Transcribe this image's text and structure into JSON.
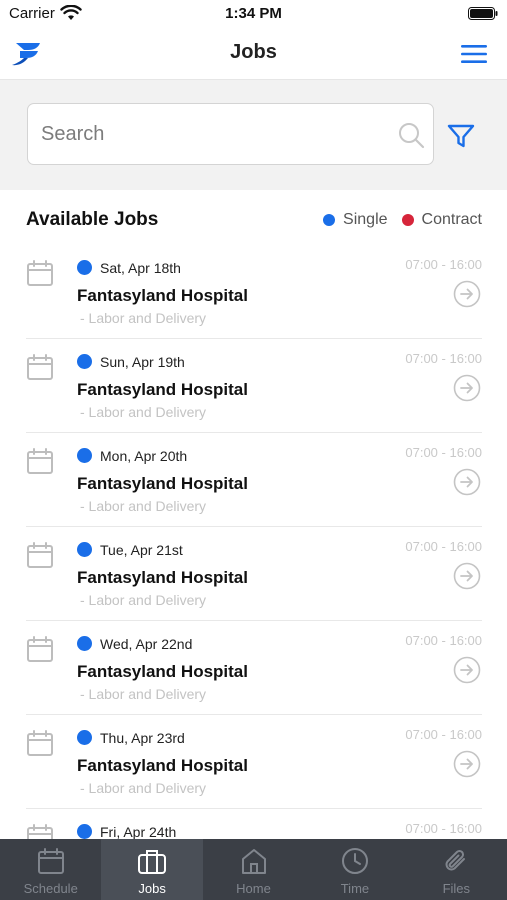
{
  "status_bar": {
    "carrier": "Carrier",
    "time": "1:34 PM"
  },
  "navbar": {
    "title": "Jobs"
  },
  "search": {
    "placeholder": "Search",
    "value": ""
  },
  "section": {
    "title": "Available Jobs",
    "legend": [
      {
        "label": "Single",
        "color": "#1a6ee8"
      },
      {
        "label": "Contract",
        "color": "#d6253a"
      }
    ]
  },
  "jobs": [
    {
      "date": "Sat, Apr 18th",
      "hospital": "Fantasyland Hospital",
      "department": "- Labor and Delivery",
      "time": "07:00 - 16:00",
      "type_color": "#1a6ee8"
    },
    {
      "date": "Sun, Apr 19th",
      "hospital": "Fantasyland Hospital",
      "department": "- Labor and Delivery",
      "time": "07:00 - 16:00",
      "type_color": "#1a6ee8"
    },
    {
      "date": "Mon, Apr 20th",
      "hospital": "Fantasyland Hospital",
      "department": "- Labor and Delivery",
      "time": "07:00 - 16:00",
      "type_color": "#1a6ee8"
    },
    {
      "date": "Tue, Apr 21st",
      "hospital": "Fantasyland Hospital",
      "department": "- Labor and Delivery",
      "time": "07:00 - 16:00",
      "type_color": "#1a6ee8"
    },
    {
      "date": "Wed, Apr 22nd",
      "hospital": "Fantasyland Hospital",
      "department": "- Labor and Delivery",
      "time": "07:00 - 16:00",
      "type_color": "#1a6ee8"
    },
    {
      "date": "Thu, Apr 23rd",
      "hospital": "Fantasyland Hospital",
      "department": "- Labor and Delivery",
      "time": "07:00 - 16:00",
      "type_color": "#1a6ee8"
    },
    {
      "date": "Fri, Apr 24th",
      "hospital": "",
      "department": "",
      "time": "07:00 - 16:00",
      "type_color": "#1a6ee8"
    }
  ],
  "tabbar": {
    "active": "Jobs",
    "tabs": [
      {
        "label": "Schedule",
        "icon": "calendar-icon"
      },
      {
        "label": "Jobs",
        "icon": "briefcase-icon"
      },
      {
        "label": "Home",
        "icon": "home-icon"
      },
      {
        "label": "Time",
        "icon": "clock-icon"
      },
      {
        "label": "Files",
        "icon": "paperclip-icon"
      }
    ]
  },
  "colors": {
    "accent": "#1a6ee8",
    "tabbar_bg": "#3b3f46"
  }
}
